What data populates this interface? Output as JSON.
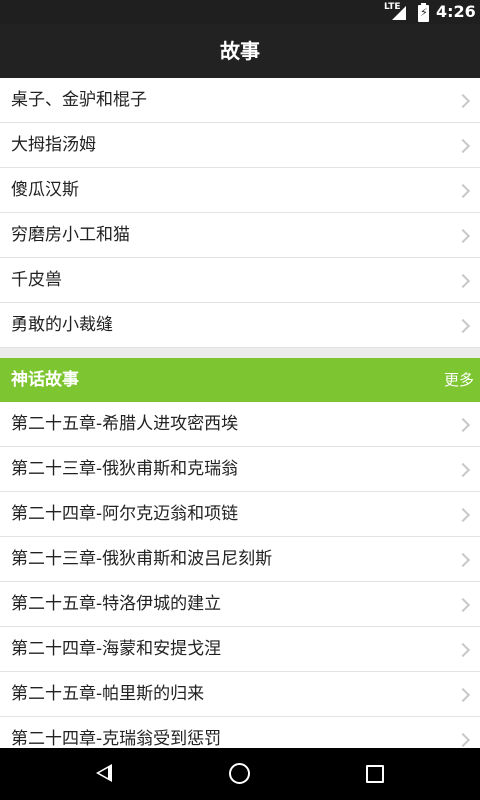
{
  "status_bar": {
    "network": "LTE",
    "time": "4:26"
  },
  "app_bar": {
    "title": "故事"
  },
  "stories": [
    "桌子、金驴和棍子",
    "大拇指汤姆",
    "傻瓜汉斯",
    "穷磨房小工和猫",
    "千皮兽",
    "勇敢的小裁缝"
  ],
  "myth_section": {
    "title": "神话故事",
    "more": "更多",
    "items": [
      "第二十五章-希腊人进攻密西埃",
      "第二十三章-俄狄甫斯和克瑞翁",
      "第二十四章-阿尔克迈翁和项链",
      "第二十三章-俄狄甫斯和波吕尼刻斯",
      "第二十五章-特洛伊城的建立",
      "第二十四章-海蒙和安提戈涅",
      "第二十五章-帕里斯的归来",
      "第二十四章-克瑞翁受到惩罚"
    ]
  },
  "colors": {
    "accent": "#7dc631",
    "app_bar": "#222222",
    "status_bar": "#1f1f1f"
  }
}
